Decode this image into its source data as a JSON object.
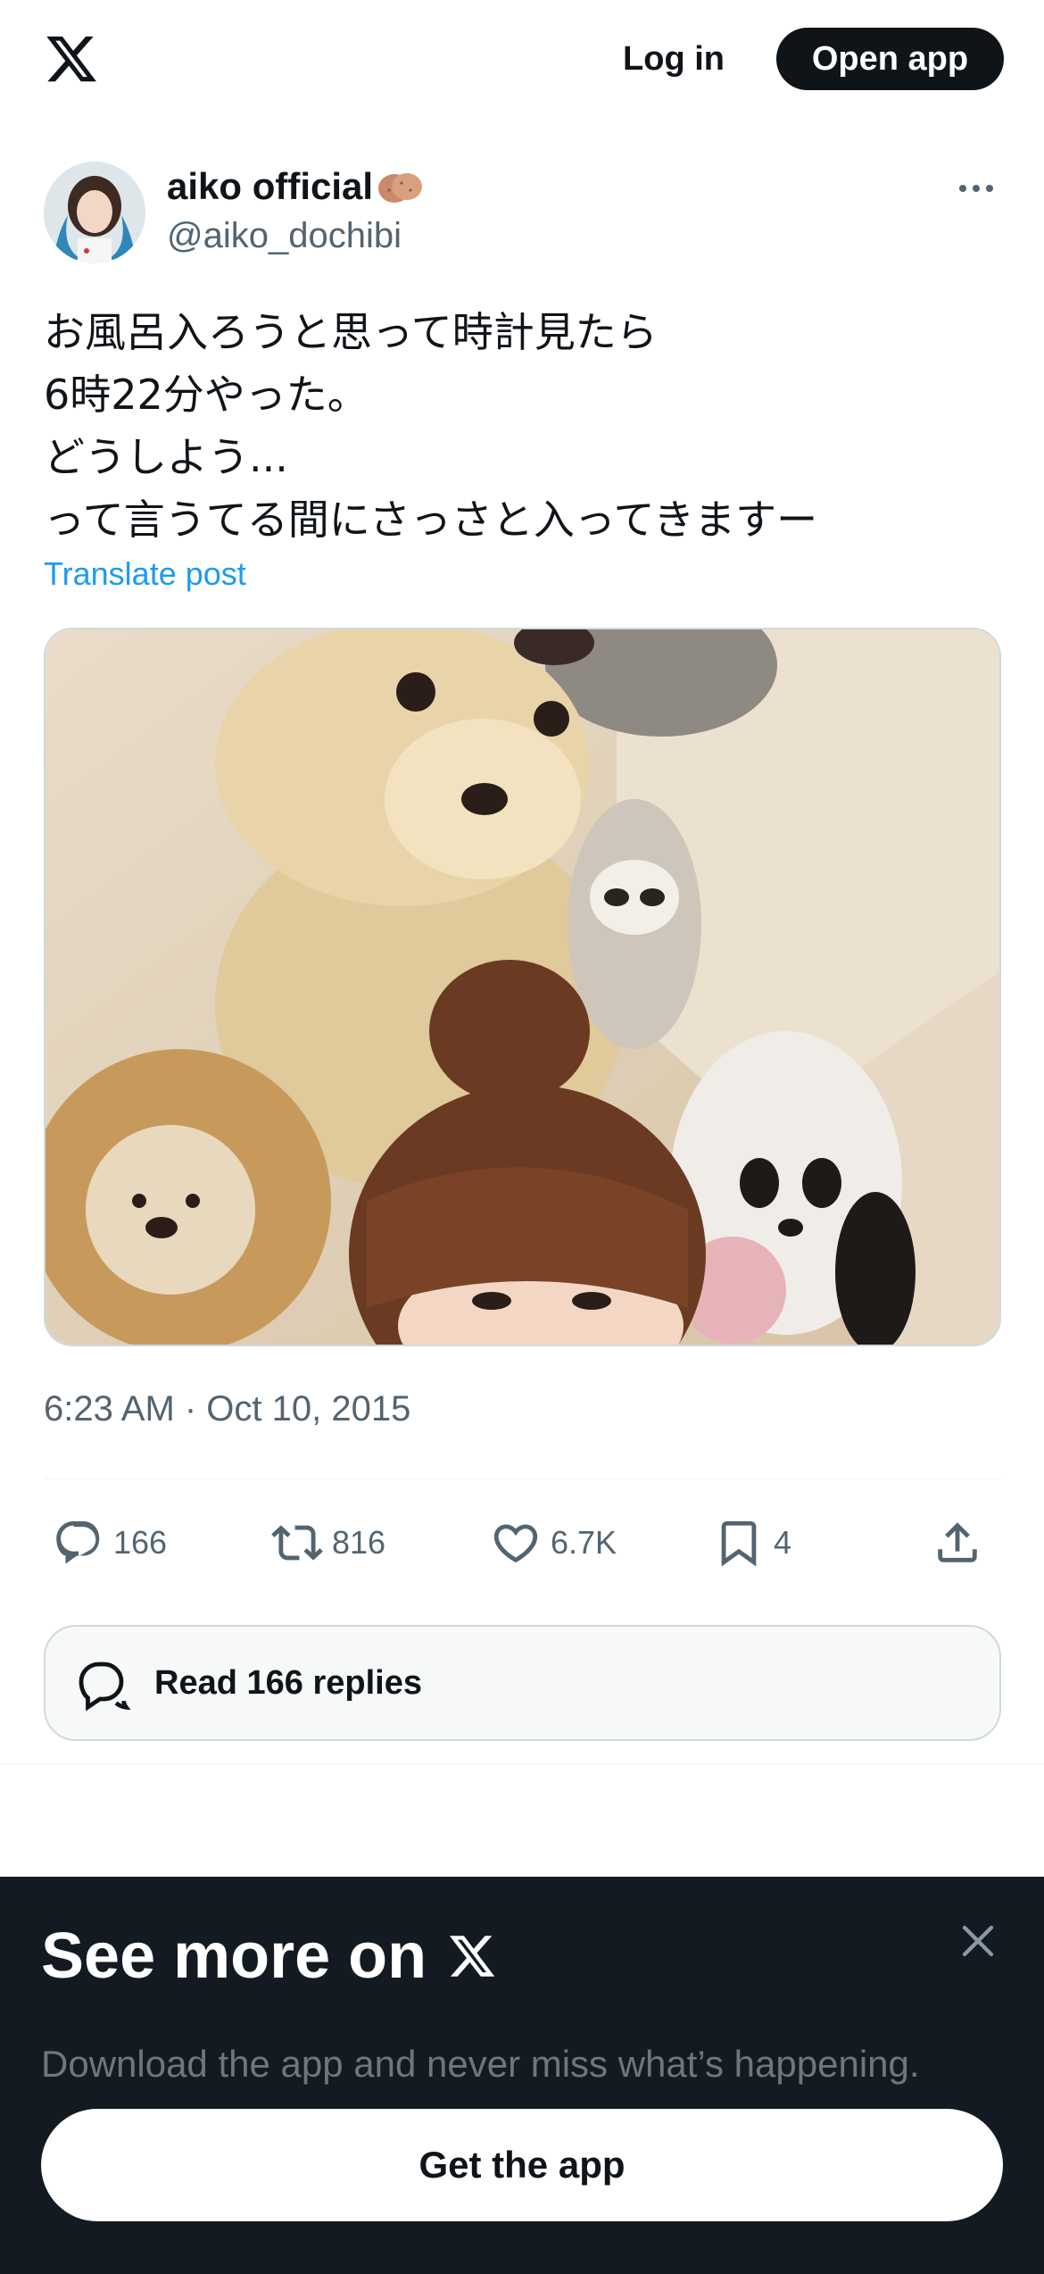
{
  "header": {
    "logo_icon": "x-logo-icon",
    "login_label": "Log in",
    "open_app_label": "Open app"
  },
  "author": {
    "name": "aiko official",
    "name_emoji_icon": "potato-icon",
    "handle": "@aiko_dochibi",
    "avatar_icon": "avatar-photo",
    "more_icon": "more-dots-icon"
  },
  "post": {
    "lines": [
      "お風呂入ろうと思って時計見たら",
      "6時22分やった。",
      "どうしよう...",
      "って言うてる間にさっさと入ってきますー"
    ],
    "translate_label": "Translate post",
    "media_icon": "photo-plush-toys",
    "timestamp": "6:23 AM · Oct 10, 2015"
  },
  "actions": {
    "replies": "166",
    "reposts": "816",
    "likes": "6.7K",
    "bookmarks": "4",
    "icons": [
      "reply-icon",
      "repost-icon",
      "like-icon",
      "bookmark-icon",
      "share-icon"
    ]
  },
  "read_replies": {
    "label": "Read 166 replies",
    "icon": "speech-bubbles-icon"
  },
  "sheet": {
    "title": "See more on",
    "subtitle": "Download the app and never miss what’s happening.",
    "button_label": "Get the app",
    "close_icon": "close-icon"
  },
  "colors": {
    "accent": "#1d9bf0",
    "text": "#0f1419",
    "muted": "#536471",
    "sheet_bg": "#141a21"
  }
}
